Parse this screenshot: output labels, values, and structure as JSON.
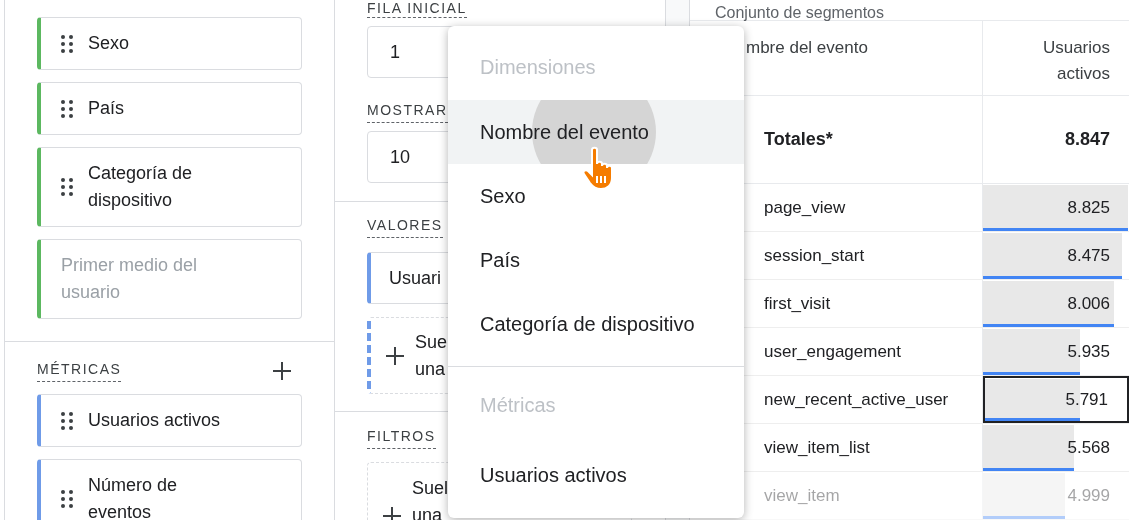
{
  "dimensions": {
    "items": [
      {
        "label": "Sexo",
        "kind": "item"
      },
      {
        "label": "País",
        "kind": "item"
      },
      {
        "label": "Categoría de dispositivo",
        "kind": "item"
      },
      {
        "label": "Primer medio del usuario",
        "kind": "placeholder"
      }
    ]
  },
  "metrics": {
    "title": "MÉTRICAS",
    "items": [
      {
        "label": "Usuarios activos"
      },
      {
        "label": "Número de eventos"
      }
    ]
  },
  "settings": {
    "start_row": {
      "label": "FILA INICIAL",
      "value": "1"
    },
    "show_rows": {
      "label": "MOSTRAR",
      "value": "10"
    },
    "values": {
      "label": "VALORES",
      "chip": "Usuari",
      "drop_zone": [
        "Sue",
        "una"
      ]
    },
    "filters": {
      "label": "FILTROS",
      "drop_zone": [
        "Suel",
        "una"
      ]
    }
  },
  "table": {
    "segment_header": "Conjunto de segmentos",
    "columns": [
      "mbre del evento",
      "Usuarios activos"
    ],
    "totals": {
      "label": "Totales*",
      "value": "8.847"
    },
    "rows": [
      {
        "name": "page_view",
        "value": "8.825",
        "level": 0.997,
        "selected": false,
        "faded": false
      },
      {
        "name": "session_start",
        "value": "8.475",
        "level": 0.958,
        "selected": false,
        "faded": false
      },
      {
        "name": "first_visit",
        "value": "8.006",
        "level": 0.905,
        "selected": false,
        "faded": false
      },
      {
        "name": "user_engagement",
        "value": "5.935",
        "level": 0.671,
        "selected": false,
        "faded": false
      },
      {
        "name": "new_recent_active_user",
        "value": "5.791",
        "level": 0.655,
        "selected": true,
        "faded": false
      },
      {
        "name": "view_item_list",
        "value": "5.568",
        "level": 0.629,
        "selected": false,
        "faded": false
      },
      {
        "name": "view_item",
        "value": "4.999",
        "level": 0.565,
        "selected": false,
        "faded": true
      }
    ]
  },
  "menu": {
    "sections": [
      {
        "title": "Dimensiones",
        "items": [
          {
            "label": "Nombre del evento",
            "selected": true
          },
          {
            "label": "Sexo",
            "selected": false
          },
          {
            "label": "País",
            "selected": false
          },
          {
            "label": "Categoría de dispositivo",
            "selected": false
          }
        ]
      },
      {
        "title": "Métricas",
        "items": [
          {
            "label": "Usuarios activos",
            "selected": false
          }
        ]
      }
    ]
  }
}
